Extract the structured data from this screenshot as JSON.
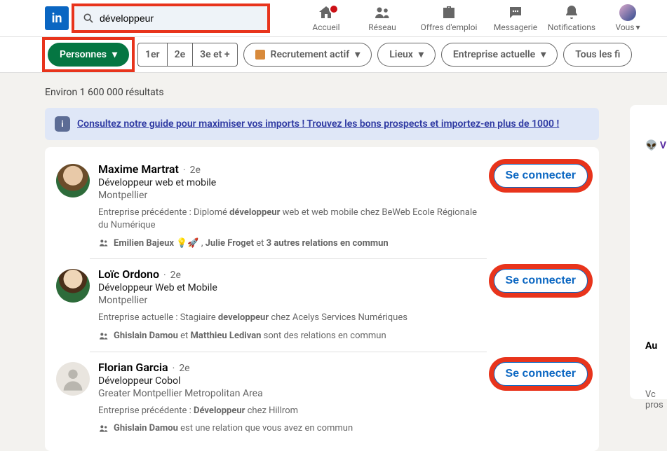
{
  "header": {
    "search_value": "développeur",
    "nav": {
      "home": "Accueil",
      "network": "Réseau",
      "jobs": "Offres d'emploi",
      "messaging": "Messagerie",
      "notifications": "Notifications",
      "me": "Vous"
    }
  },
  "filters": {
    "people": "Personnes",
    "degrees": {
      "first": "1er",
      "second": "2e",
      "third_plus": "3e et +"
    },
    "actively_recruiting": "Recrutement actif",
    "locations": "Lieux",
    "current_company": "Entreprise actuelle",
    "all_filters": "Tous les fi"
  },
  "results_count": "Environ 1 600 000 résultats",
  "guide": {
    "text": "Consultez notre guide pour maximiser vos imports ! Trouvez les bons prospects et importez-en plus de 1000 !"
  },
  "connect_label": "Se connecter",
  "results": [
    {
      "name": "Maxime Martrat",
      "degree": "2e",
      "title": "Développeur web et mobile",
      "location": "Montpellier",
      "snippet_prefix": "Entreprise précédente  : Diplomé ",
      "snippet_bold": "développeur",
      "snippet_suffix": " web et web mobile chez BeWeb Ecole Régionale du Numérique",
      "insights_prefix": "Emilien Bajeux",
      "insights_mid": " 💡🚀 , ",
      "insights_name2": "Julie Froget",
      "insights_suffix": " et ",
      "insights_tail": "3 autres relations en commun"
    },
    {
      "name": "Loïc Ordono",
      "degree": "2e",
      "title": "Développeur Web et Mobile",
      "location": "Montpellier",
      "snippet_prefix": "Entreprise actuelle  : Stagiaire ",
      "snippet_bold": "developpeur",
      "snippet_suffix": " chez Acelys Services Numériques",
      "insights_prefix": "Ghislain Damou",
      "insights_mid": " et ",
      "insights_name2": "Matthieu Ledivan",
      "insights_suffix": " sont des relations en commun",
      "insights_tail": ""
    },
    {
      "name": "Florian Garcia",
      "degree": "2e",
      "title": "Développeur Cobol",
      "location": "Greater Montpellier Metropolitan Area",
      "snippet_prefix": "Entreprise précédente  : ",
      "snippet_bold": "Développeur",
      "snippet_suffix": " chez Hillrom",
      "insights_prefix": "Ghislain Damou",
      "insights_mid": "",
      "insights_name2": "",
      "insights_suffix": " est une relation que vous avez en commun",
      "insights_tail": ""
    }
  ],
  "sidebar_peek": {
    "line1": "👽 V",
    "line2": "Au",
    "line3": "Vc\npros"
  }
}
